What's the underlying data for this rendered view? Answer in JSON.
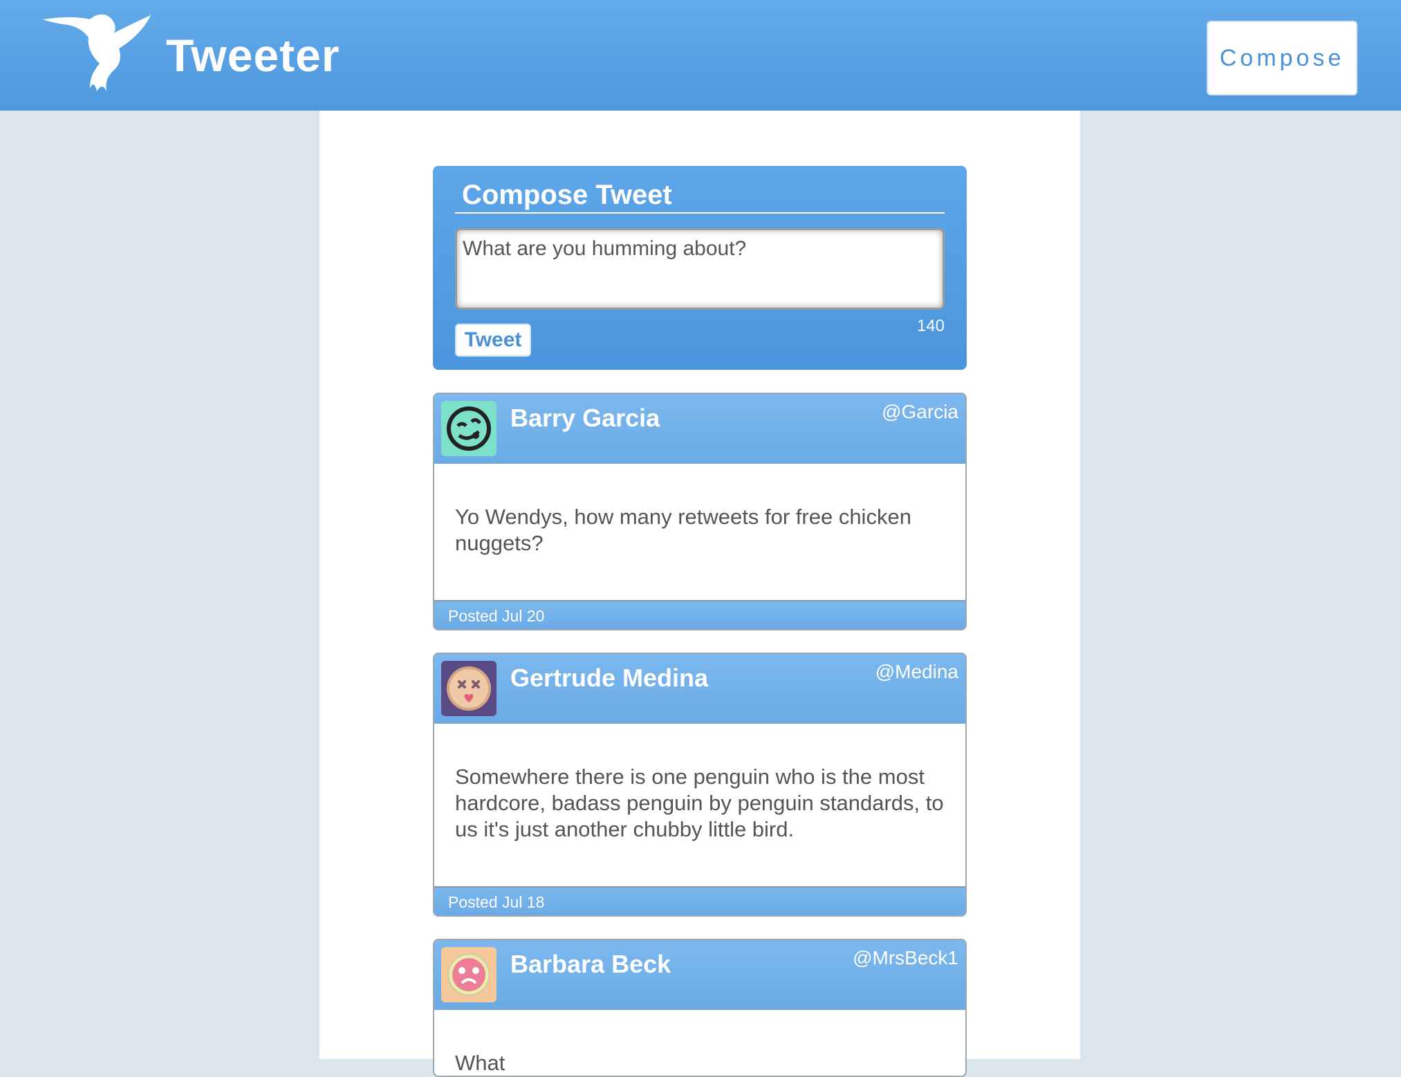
{
  "header": {
    "brand": "Tweeter",
    "compose_label": "Compose",
    "logo_icon": "hummingbird-icon"
  },
  "composer": {
    "title": "Compose Tweet",
    "placeholder": "What are you humming about?",
    "submit_label": "Tweet",
    "char_count": "140"
  },
  "tweets": [
    {
      "name": "Barry Garcia",
      "handle": "@Garcia",
      "text": "Yo Wendys, how many retweets for free chicken nuggets?",
      "posted": "Posted Jul 20",
      "avatar": "tongue-out-face-icon",
      "avatar_bg": "#7de0c8"
    },
    {
      "name": "Gertrude Medina",
      "handle": "@Medina",
      "text": "Somewhere there is one penguin who is the most hardcore, badass penguin by penguin standards, to us it's just another chubby little bird.",
      "posted": "Posted Jul 18",
      "avatar": "dizzy-face-icon",
      "avatar_bg": "#5a4a86"
    },
    {
      "name": "Barbara Beck",
      "handle": "@MrsBeck1",
      "text": "What",
      "posted": "",
      "avatar": "surprised-face-icon",
      "avatar_bg": "#f6c99a"
    }
  ],
  "colors": {
    "header_blue": "#5aa2e6",
    "page_bg": "#dbe5ec",
    "accent": "#4a90d9"
  }
}
